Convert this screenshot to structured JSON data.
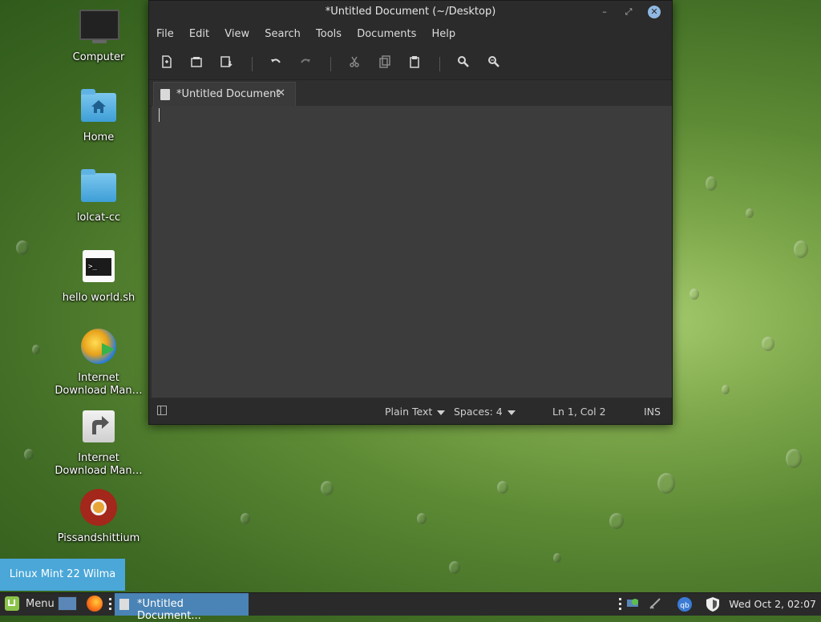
{
  "desktop": {
    "icons": [
      {
        "label": "Computer",
        "icon": "computer-icon"
      },
      {
        "label": "Home",
        "icon": "home-folder-icon"
      },
      {
        "label": "lolcat-cc",
        "icon": "folder-icon"
      },
      {
        "label": "hello world.sh",
        "icon": "terminal-script-icon"
      },
      {
        "label": "Internet Download Man…",
        "icon": "idm-icon"
      },
      {
        "label": "Internet Download Man…",
        "icon": "shortcut-icon"
      },
      {
        "label": "Pissandshittium",
        "icon": "chromium-icon"
      }
    ]
  },
  "window": {
    "title": "*Untitled Document (~/Desktop)",
    "controls": {
      "minimize": "–",
      "maximize": "⤢",
      "close": "✕"
    },
    "menu": [
      "File",
      "Edit",
      "View",
      "Search",
      "Tools",
      "Documents",
      "Help"
    ],
    "toolbar_icons": [
      "new-document-icon",
      "open-icon",
      "save-icon",
      "undo-icon",
      "redo-icon",
      "cut-icon",
      "copy-icon",
      "paste-icon",
      "find-icon",
      "find-replace-icon"
    ],
    "tab": {
      "label": "*Untitled Document",
      "close": "✕"
    },
    "editor_text": "",
    "status": {
      "language": "Plain Text",
      "spaces": "Spaces: 4",
      "position": "Ln 1, Col 2",
      "mode": "INS"
    }
  },
  "notification": {
    "text": "Linux Mint 22 Wilma"
  },
  "panel": {
    "menu_label": "Menu",
    "task_label": "*Untitled Document...",
    "clock": "Wed Oct  2, 02:07"
  },
  "colors": {
    "accent": "#4aa7d8",
    "task_active": "#4a83b5",
    "mint_green": "#8ac34a"
  }
}
